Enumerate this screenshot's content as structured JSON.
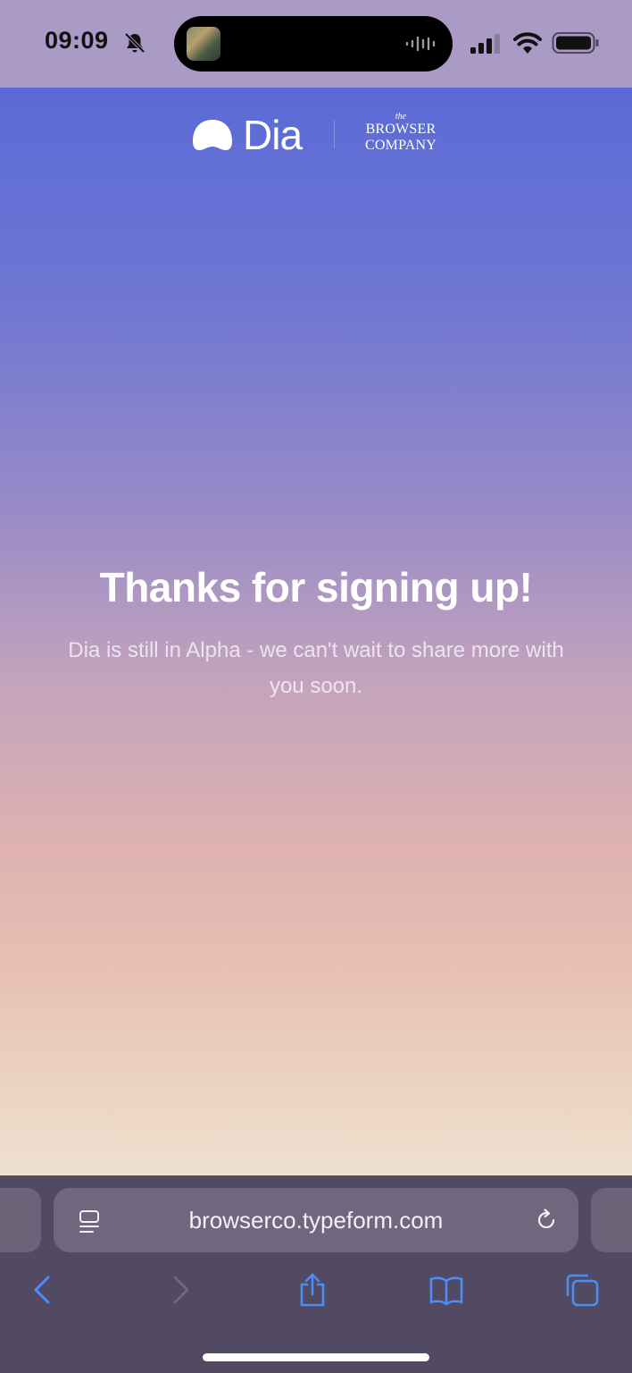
{
  "status_bar": {
    "time": "09:09",
    "icons": [
      "bell-slash-icon",
      "cellular-signal-icon",
      "wifi-icon",
      "battery-icon"
    ]
  },
  "header": {
    "brand_name": "Dia",
    "company_line1": "BROWSER",
    "company_line2": "COMPANY",
    "company_prefix": "the"
  },
  "hero": {
    "title": "Thanks for signing up!",
    "subtitle": "Dia is still in Alpha - we can't wait to share more with you soon."
  },
  "browser": {
    "url": "browserco.typeform.com",
    "toolbar_icons": [
      "back-chevron-icon",
      "forward-chevron-icon",
      "share-icon",
      "bookmarks-icon",
      "tabs-icon"
    ]
  },
  "colors": {
    "gradient_top": "#5a6ad6",
    "gradient_bottom": "#efe0cf",
    "status_bar_bg": "#a99ac6",
    "chrome_bg": "#524a63",
    "accent_blue": "#4a8df5"
  }
}
